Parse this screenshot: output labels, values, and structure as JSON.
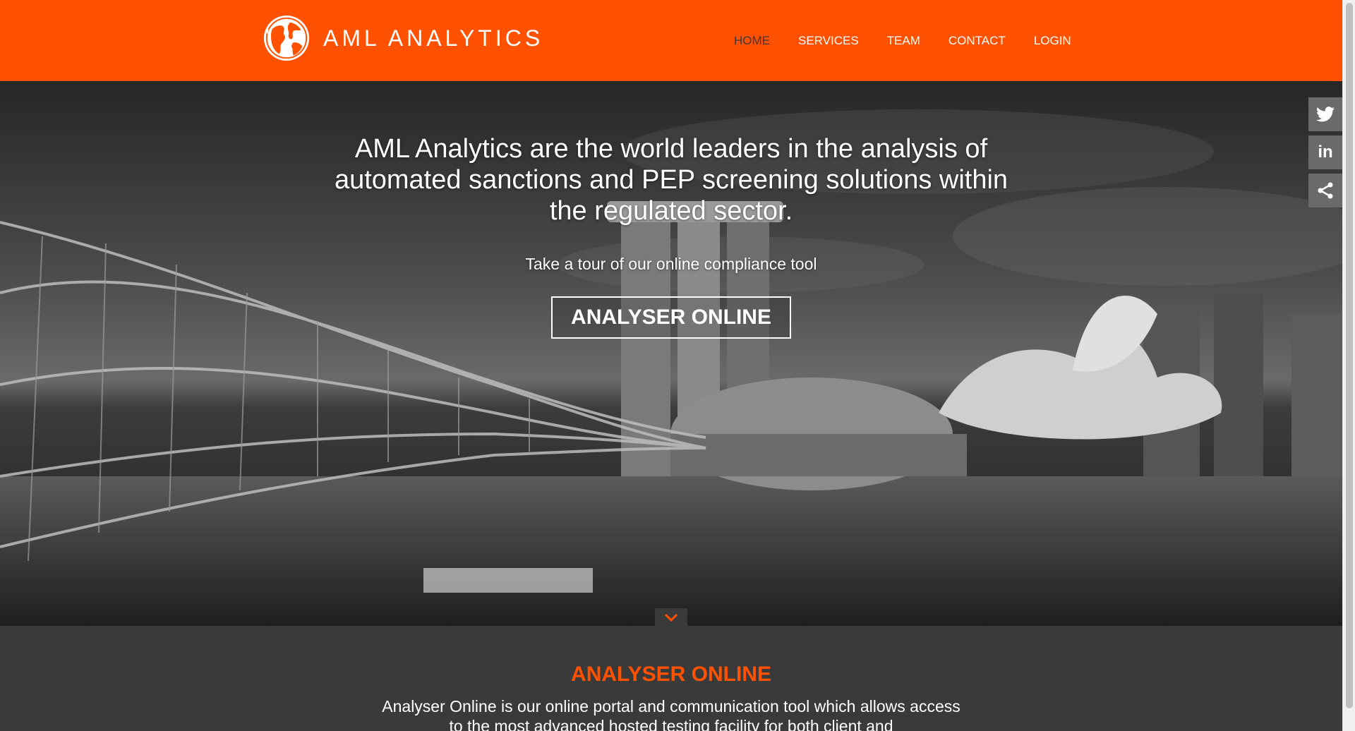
{
  "brand": {
    "name": "AML ANALYTICS",
    "logo_icon": "globe-icon",
    "accent_color": "#ff5100"
  },
  "nav": {
    "items": [
      {
        "label": "HOME",
        "active": true
      },
      {
        "label": "SERVICES",
        "active": false
      },
      {
        "label": "TEAM",
        "active": false
      },
      {
        "label": "CONTACT",
        "active": false
      },
      {
        "label": "LOGIN",
        "active": false
      }
    ]
  },
  "hero": {
    "headline": "AML Analytics are the world leaders in the analysis of automated sanctions and PEP screening solutions within the regulated sector.",
    "subheadline": "Take a tour of our online compliance tool",
    "button_label": "ANALYSER ONLINE",
    "scroll_icon": "chevron-down-icon"
  },
  "social": {
    "buttons": [
      {
        "icon": "twitter-icon"
      },
      {
        "icon": "linkedin-icon",
        "glyph": "in"
      },
      {
        "icon": "share-icon"
      }
    ]
  },
  "section": {
    "title": "ANALYSER ONLINE",
    "body": "Analyser Online is our online portal and communication tool which allows access to the most advanced hosted testing facility for both client and"
  }
}
